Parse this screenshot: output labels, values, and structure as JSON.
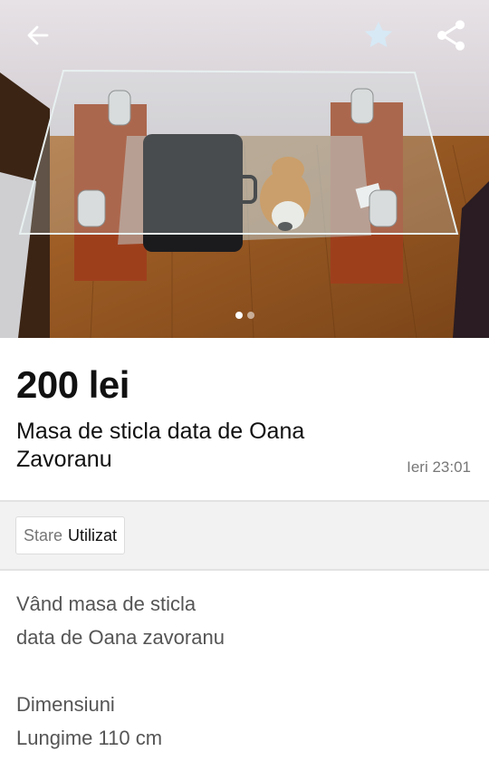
{
  "listing": {
    "price": "200 lei",
    "title": "Masa de sticla data de Oana Zavoranu",
    "date": "Ieri 23:01"
  },
  "gallery": {
    "image_description": "Glass coffee table with wooden legs on laminate floor, bag and plush toy on lower shelf",
    "total_images": 2,
    "active_index": 0
  },
  "toolbar": {
    "back_icon": "arrow-left-icon",
    "favorite_icon": "star-icon",
    "share_icon": "share-icon"
  },
  "params": [
    {
      "key": "Stare",
      "value": "Utilizat"
    }
  ],
  "description": {
    "lines": [
      "Vând masa de sticla",
      "data de Oana zavoranu",
      "",
      "Dimensiuni",
      "Lungime 110 cm"
    ]
  },
  "colors": {
    "price_text": "#111111",
    "date_text": "#777777",
    "params_bg": "#f2f2f2",
    "description_text": "#555555"
  }
}
